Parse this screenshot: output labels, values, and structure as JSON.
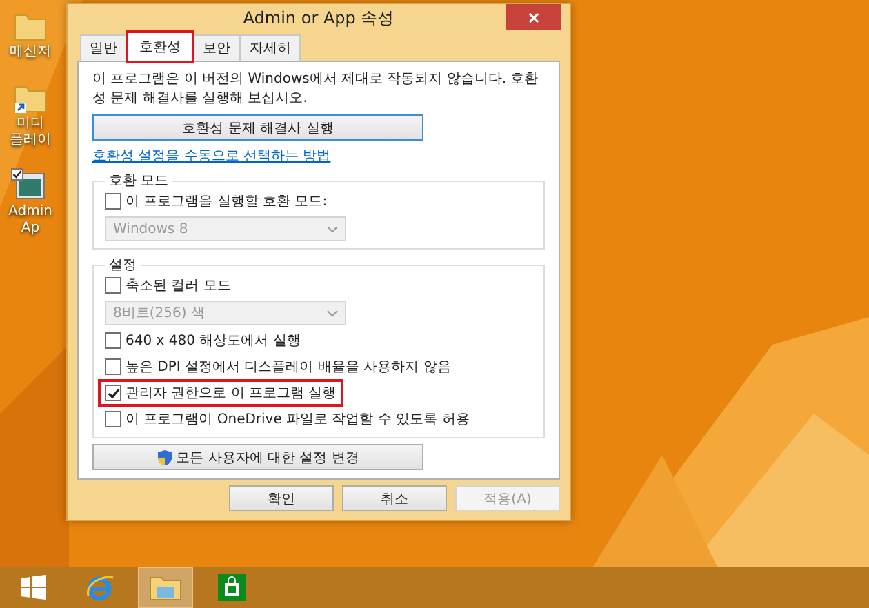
{
  "desktop_icons": [
    {
      "kind": "folder",
      "lines": [
        "메신저"
      ],
      "checked": false
    },
    {
      "kind": "shortcut",
      "lines": [
        "미디",
        "플레이"
      ],
      "checked": false
    },
    {
      "kind": "app",
      "lines": [
        "Admin",
        "Ap"
      ],
      "checked": true
    }
  ],
  "window": {
    "title": "Admin or App 속성"
  },
  "tabs": [
    {
      "label": "일반",
      "selected": false,
      "highlighted": false
    },
    {
      "label": "호환성",
      "selected": true,
      "highlighted": true
    },
    {
      "label": "보안",
      "selected": false,
      "highlighted": false
    },
    {
      "label": "자세히",
      "selected": false,
      "highlighted": false
    }
  ],
  "intro": "이 프로그램은 이 버전의 Windows에서 제대로 작동되지 않습니다. 호환성 문제 해결사를 실행해 보십시오.",
  "troubleshooter_button": "호환성 문제 해결사 실행",
  "manual_link": "호환성 설정을 수동으로 선택하는 방법",
  "groups": [
    {
      "title": "호환 모드",
      "items": [
        {
          "kind": "checkbox",
          "label": "이 프로그램을 실행할 호환 모드:",
          "checked": false,
          "highlighted": false
        },
        {
          "kind": "select",
          "value": "Windows 8",
          "disabled": true
        }
      ]
    },
    {
      "title": "설정",
      "items": [
        {
          "kind": "checkbox",
          "label": "축소된 컬러 모드",
          "checked": false,
          "highlighted": false
        },
        {
          "kind": "select",
          "value": "8비트(256) 색",
          "disabled": true
        },
        {
          "kind": "checkbox",
          "label": "640 x 480 해상도에서 실행",
          "checked": false,
          "highlighted": false
        },
        {
          "kind": "checkbox",
          "label": "높은 DPI 설정에서 디스플레이 배율을 사용하지 않음",
          "checked": false,
          "highlighted": false
        },
        {
          "kind": "checkbox",
          "label": "관리자 권한으로 이 프로그램 실행",
          "checked": true,
          "highlighted": true
        },
        {
          "kind": "checkbox",
          "label": "이 프로그램이 OneDrive 파일로 작업할 수 있도록 허용",
          "checked": false,
          "highlighted": false
        }
      ]
    }
  ],
  "all_users_button": "모든 사용자에 대한 설정 변경",
  "buttons": [
    {
      "label": "확인",
      "disabled": false
    },
    {
      "label": "취소",
      "disabled": false
    },
    {
      "label": "적용(A)",
      "disabled": true
    }
  ],
  "taskbar": [
    {
      "kind": "start",
      "selected": false
    },
    {
      "kind": "browser",
      "selected": false
    },
    {
      "kind": "explorer",
      "selected": true
    },
    {
      "kind": "store",
      "selected": false
    }
  ]
}
